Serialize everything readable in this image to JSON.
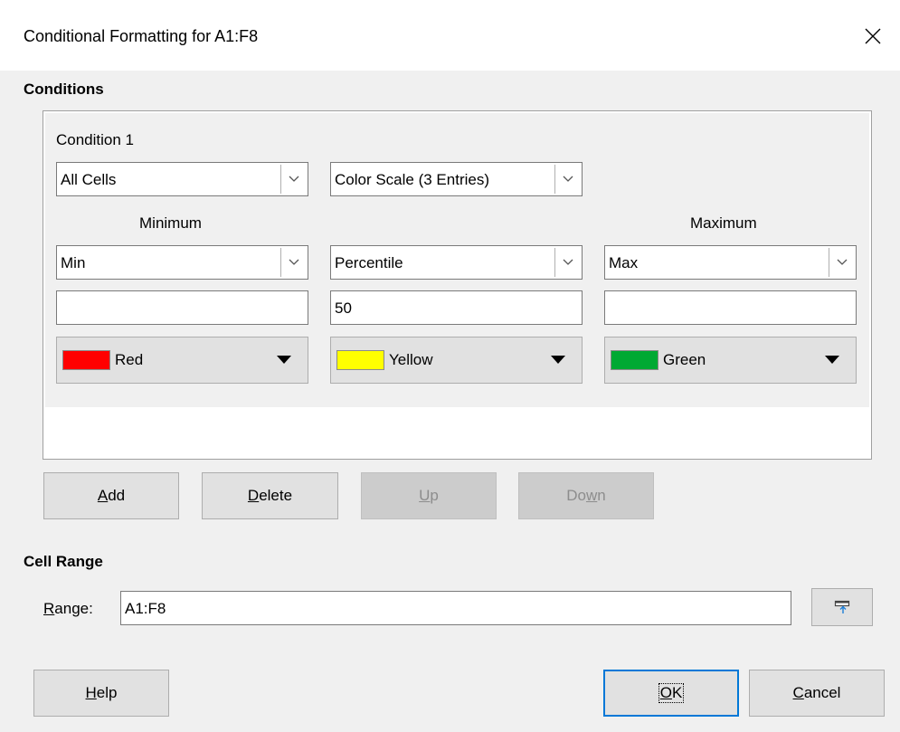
{
  "window": {
    "title": "Conditional Formatting for A1:F8",
    "close_icon": "close-icon"
  },
  "conditions": {
    "heading": "Conditions",
    "condition": {
      "label": "Condition 1",
      "applies_to": "All Cells",
      "style": "Color Scale (3 Entries)",
      "min_heading": "Minimum",
      "max_heading": "Maximum",
      "entries": [
        {
          "type": "Min",
          "value": "",
          "color_name": "Red",
          "color": "#ff0000"
        },
        {
          "type": "Percentile",
          "value": "50",
          "color_name": "Yellow",
          "color": "#ffff00"
        },
        {
          "type": "Max",
          "value": "",
          "color_name": "Green",
          "color": "#00a933"
        }
      ]
    },
    "buttons": {
      "add": {
        "pre": "",
        "mn": "A",
        "post": "dd"
      },
      "delete": {
        "pre": "",
        "mn": "D",
        "post": "elete"
      },
      "up": {
        "pre": "",
        "mn": "U",
        "post": "p"
      },
      "down": {
        "pre": "Do",
        "mn": "w",
        "post": "n"
      }
    }
  },
  "cell_range": {
    "heading": "Cell Range",
    "label": {
      "pre": "",
      "mn": "R",
      "post": "ange:"
    },
    "value": "A1:F8",
    "shrink_icon": "shrink-range-icon"
  },
  "footer": {
    "help": {
      "pre": "",
      "mn": "H",
      "post": "elp"
    },
    "ok": {
      "pre": "",
      "mn": "O",
      "post": "K"
    },
    "cancel": {
      "pre": "",
      "mn": "C",
      "post": "ancel"
    }
  }
}
